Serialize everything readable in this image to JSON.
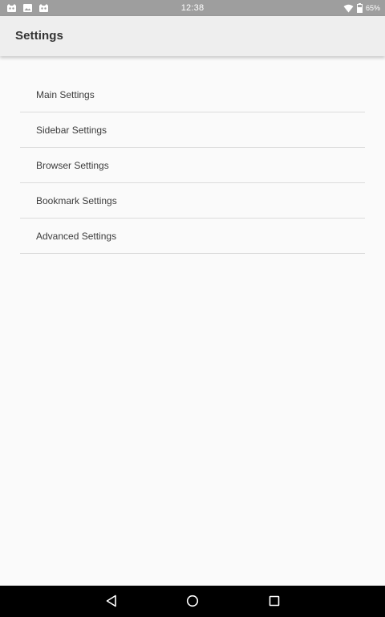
{
  "status_bar": {
    "time": "12:38",
    "battery_percent": "65%",
    "left_icons": [
      "cat-app-icon",
      "image-app-icon",
      "cat-app-icon"
    ],
    "right_icons": [
      "wifi-icon",
      "battery-icon"
    ],
    "background": "#9e9e9e"
  },
  "app_bar": {
    "title": "Settings",
    "background": "#eeeeee"
  },
  "settings": {
    "items": [
      {
        "label": "Main Settings"
      },
      {
        "label": "Sidebar Settings"
      },
      {
        "label": "Browser Settings"
      },
      {
        "label": "Bookmark Settings"
      },
      {
        "label": "Advanced Settings"
      }
    ]
  },
  "nav_bar": {
    "buttons": [
      "back-icon",
      "home-icon",
      "recents-icon"
    ],
    "background": "#000000"
  }
}
